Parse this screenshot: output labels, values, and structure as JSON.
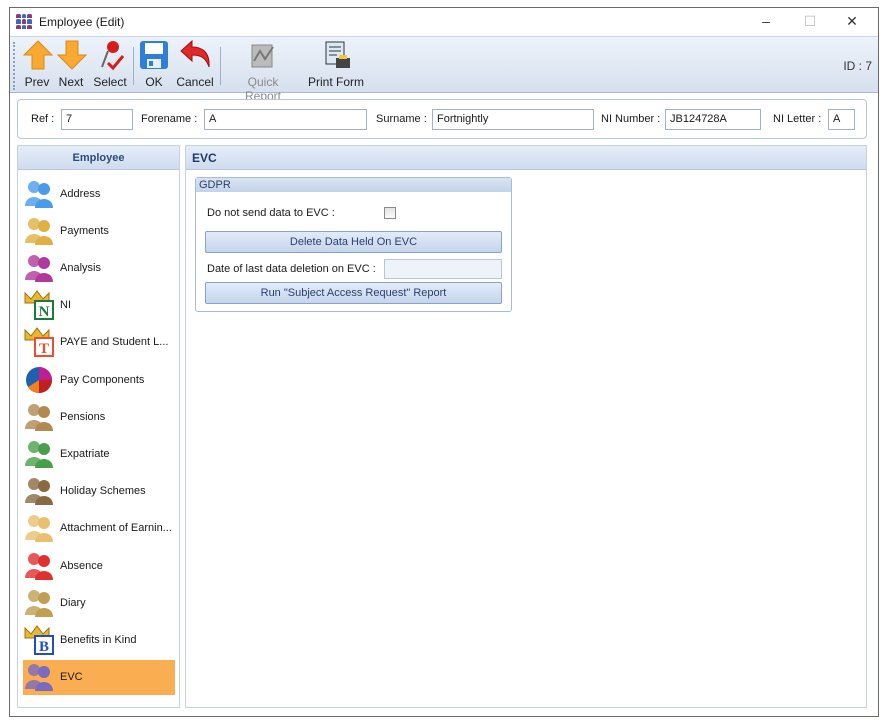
{
  "window": {
    "title": "Employee (Edit)",
    "minimize": "–",
    "maximize": "☐",
    "close": "✕"
  },
  "toolbar": {
    "buttons": [
      {
        "label": "Prev",
        "icon": "arrow-up-icon"
      },
      {
        "label": "Next",
        "icon": "arrow-down-icon"
      },
      {
        "label": "Select",
        "icon": "pushpin-icon"
      },
      {
        "label": "OK",
        "icon": "floppy-disk-icon"
      },
      {
        "label": "Cancel",
        "icon": "undo-arrow-icon"
      },
      {
        "label": "Quick Report",
        "icon": "report-icon",
        "disabled": true
      },
      {
        "label": "Print Form",
        "icon": "print-form-icon"
      }
    ],
    "id_label": "ID : 7"
  },
  "header": {
    "ref_label": "Ref :",
    "ref": "7",
    "forename_label": "Forename :",
    "forename": "A",
    "surname_label": "Surname :",
    "surname": "Fortnightly",
    "ni_number_label": "NI Number :",
    "ni_number": "JB124728A",
    "ni_letter_label": "NI Letter :",
    "ni_letter": "A"
  },
  "sidebar": {
    "title": "Employee",
    "items": [
      {
        "label": "Address",
        "icon": "people-icon"
      },
      {
        "label": "Payments",
        "icon": "piggy-bank-icon"
      },
      {
        "label": "Analysis",
        "icon": "group-pyramid-icon"
      },
      {
        "label": "NI",
        "icon": "crown-n-icon"
      },
      {
        "label": "PAYE and Student L...",
        "icon": "crown-t-icon"
      },
      {
        "label": "Pay Components",
        "icon": "pie-chart-icon"
      },
      {
        "label": "Pensions",
        "icon": "pension-jar-icon"
      },
      {
        "label": "Expatriate",
        "icon": "globe-plane-icon"
      },
      {
        "label": "Holiday Schemes",
        "icon": "holiday-people-icon"
      },
      {
        "label": "Attachment of Earnin...",
        "icon": "attachment-icon"
      },
      {
        "label": "Absence",
        "icon": "office-chair-icon"
      },
      {
        "label": "Diary",
        "icon": "diary-clock-icon"
      },
      {
        "label": "Benefits in Kind",
        "icon": "crown-b-icon"
      },
      {
        "label": "EVC",
        "icon": "people-gear-icon",
        "selected": true
      }
    ]
  },
  "main": {
    "title": "EVC",
    "group_title": "GDPR",
    "no_send_label": "Do not send data to EVC :",
    "no_send_checked": false,
    "delete_button": "Delete Data Held On EVC",
    "last_deletion_label": "Date of last data deletion on EVC :",
    "last_deletion_value": "",
    "sar_button": "Run \"Subject Access Request\" Report"
  },
  "colors": {
    "selected": "#fbad52",
    "header_gradient": "#cfdcef",
    "accent_text": "#2b4a80"
  }
}
